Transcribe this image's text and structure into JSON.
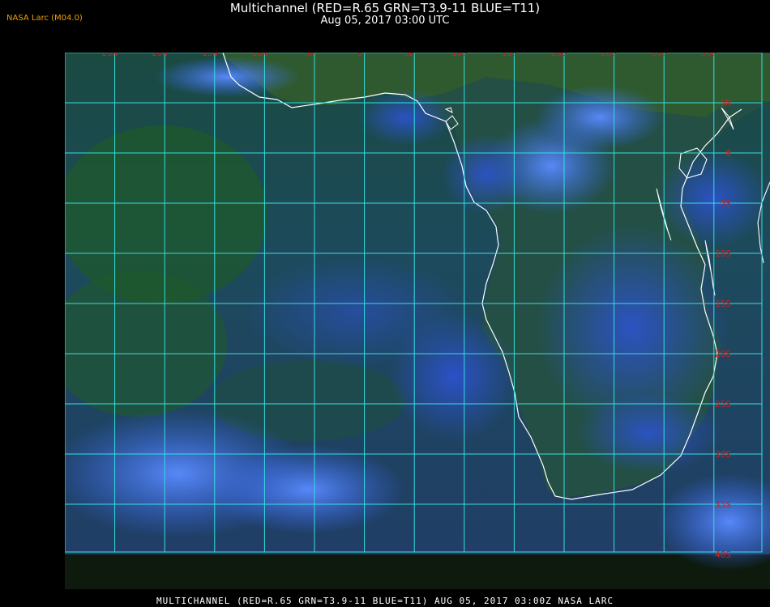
{
  "header": {
    "title": "Multichannel (RED=R.65 GRN=T3.9-11 BLUE=T11)",
    "datetime": "Aug 05, 2017 03:00 UTC",
    "badge": "NASA Larc (M04.0)"
  },
  "map": {
    "lon_labels": [
      "25W",
      "20W",
      "15W",
      "10W",
      "5W",
      "0",
      "5E",
      "10E",
      "15E",
      "20E",
      "25E",
      "30E",
      "35E"
    ],
    "lat_labels": [
      "5N",
      "0",
      "5S",
      "10S",
      "15S",
      "20S",
      "25S",
      "30S",
      "35S",
      "40S"
    ],
    "colors": {
      "grid": "#33e0e0",
      "label": "#d02020",
      "coast": "#ffffff",
      "ocean": "#1f4f6a",
      "land": "#2a5a2a",
      "cloud": "#3a6cff"
    }
  },
  "footer": "MULTICHANNEL (RED=R.65 GRN=T3.9-11 BLUE=T11) AUG 05, 2017 03:00Z  NASA LARC"
}
